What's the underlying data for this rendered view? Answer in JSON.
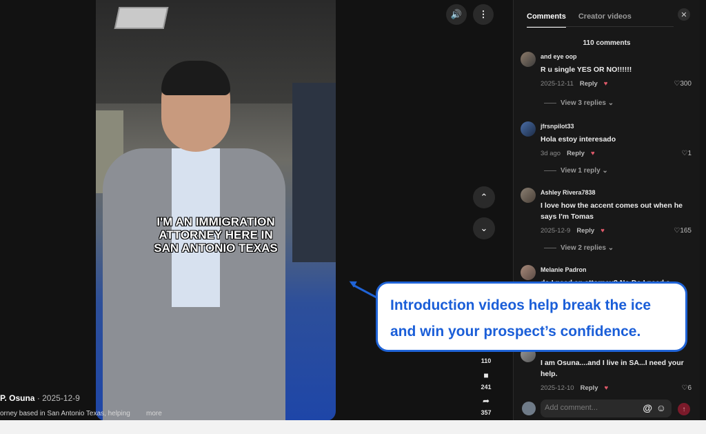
{
  "video": {
    "caption_lines": [
      "I'M AN IMMIGRATION",
      "ATTORNEY HERE IN",
      "SAN ANTONIO TEXAS"
    ]
  },
  "author": {
    "name": "P. Osuna",
    "date": " · 2025-12-9",
    "description": "orney based in San Antonio Texas, helping",
    "more": "more"
  },
  "controls": {
    "volume_icon": "volume-icon",
    "menu_icon": "more-vertical-icon"
  },
  "actions": {
    "comments_count": "110",
    "bookmarks_count": "241",
    "shares_count": "357"
  },
  "panel": {
    "tab_comments": "Comments",
    "tab_creator": "Creator videos",
    "count": "110 comments",
    "comments": [
      {
        "user": "and eye oop",
        "text": "R u single YES OR NO!!!!!!",
        "date": "2025-12-11",
        "reply": "Reply",
        "likes": "300",
        "view_replies": "View 3 replies"
      },
      {
        "user": "jfrsnpilot33",
        "text": "Hola estoy interesado",
        "date": "3d ago",
        "reply": "Reply",
        "likes": "1",
        "view_replies": "View 1 reply"
      },
      {
        "user": "Ashley Rivera7838",
        "text": "I love how the accent comes out when he says I'm Tomas",
        "date": "2025-12-9",
        "reply": "Reply",
        "likes": "165",
        "view_replies": "View 2 replies"
      },
      {
        "user": "Melanie Padron",
        "text": "do I need an attorney? No Do I need a"
      },
      {
        "text": "I am Osuna....and I live in SA...I need your help.",
        "date": "2025-12-10",
        "reply": "Reply",
        "likes": "6"
      }
    ],
    "input_placeholder": "Add comment..."
  },
  "callout": {
    "line1": "Introduction videos help break the ice",
    "line2": "and win your prospect’s confidence."
  },
  "colors": {
    "accent": "#1f63d6",
    "panel_bg": "#181818"
  }
}
